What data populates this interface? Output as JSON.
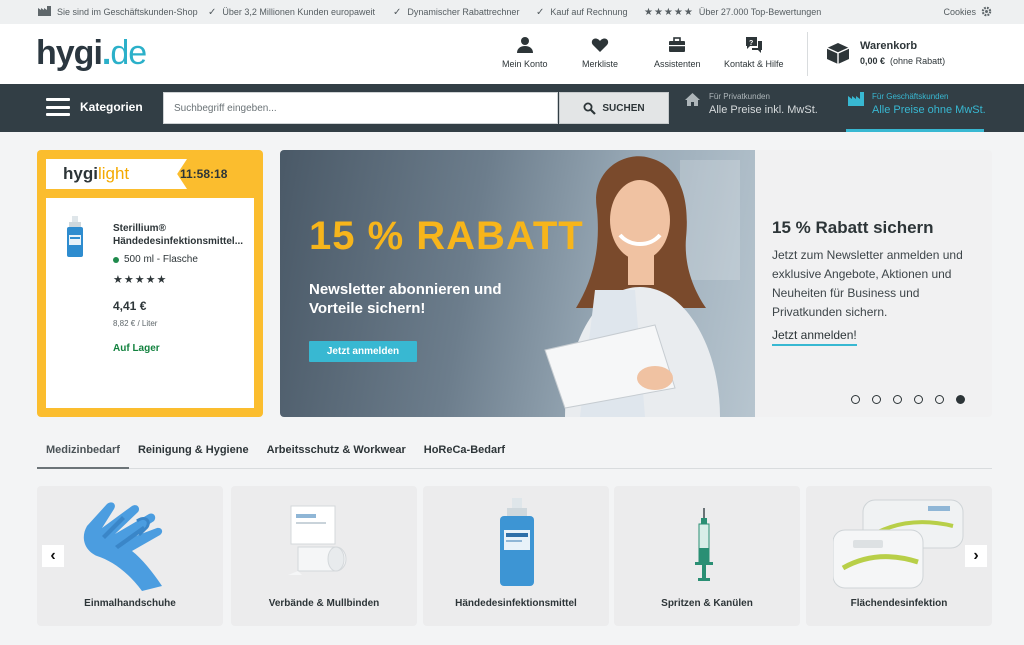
{
  "topbar": {
    "usps": [
      "Sie sind im Geschäftskunden-Shop",
      "Über 3,2 Millionen Kunden europaweit",
      "Dynamischer Rabattrechner",
      "Kauf auf Rechnung",
      "Über 27.000 Top-Bewertungen"
    ],
    "stars": "★★★★★",
    "cookies": "Cookies"
  },
  "header": {
    "logo_main": "hygi",
    "logo_dot": ".",
    "logo_tld": "de",
    "nav": [
      "Mein Konto",
      "Merkliste",
      "Assistenten",
      "Kontakt & Hilfe"
    ],
    "cart_title": "Warenkorb",
    "cart_amount": "0,00 €",
    "cart_note": "(ohne Rabatt)"
  },
  "darkbar": {
    "categories": "Kategorien",
    "search_placeholder": "Suchbegriff eingeben...",
    "search_button": "SUCHEN",
    "private_small": "Für Privatkunden",
    "private_big": "Alle Preise inkl. MwSt.",
    "business_small": "Für Geschäftskunden",
    "business_big": "Alle Preise ohne MwSt."
  },
  "deal": {
    "badge_a": "hygi",
    "badge_b": "light",
    "timer": "11:58:18",
    "product_name_1": "Sterillium®",
    "product_name_2": "Händedesinfektionsmittel...",
    "variant": "500 ml - Flasche",
    "rating": "★★★★★",
    "price": "4,41 €",
    "unit_price": "8,82 € / Liter",
    "stock": "Auf Lager"
  },
  "banner": {
    "title": "15 % RABATT",
    "subtitle": "Newsletter abonnieren und Vorteile sichern!",
    "button": "Jetzt anmelden",
    "side_title": "15 % Rabatt sichern",
    "side_text": "Jetzt zum Newsletter anmelden und exklusive Angebote, Aktionen und Neuheiten für Business und Privatkunden sichern.",
    "side_link": "Jetzt anmelden!",
    "slide_count": 6,
    "active_slide": 6
  },
  "tabs": [
    "Medizinbedarf",
    "Reinigung & Hygiene",
    "Arbeitsschutz & Workwear",
    "HoReCa-Bedarf"
  ],
  "tiles": [
    "Einmalhandschuhe",
    "Verbände & Mullbinden",
    "Händedesinfektionsmittel",
    "Spritzen & Kanülen",
    "Flächendesinfektion"
  ],
  "arrows": {
    "prev": "‹",
    "next": "›"
  },
  "colors": {
    "accent": "#38b8d2",
    "deal_yellow": "#fbbd2e",
    "dark_bar": "#323e45",
    "banner_title": "#f7b51b",
    "stock_green": "#13823f"
  }
}
